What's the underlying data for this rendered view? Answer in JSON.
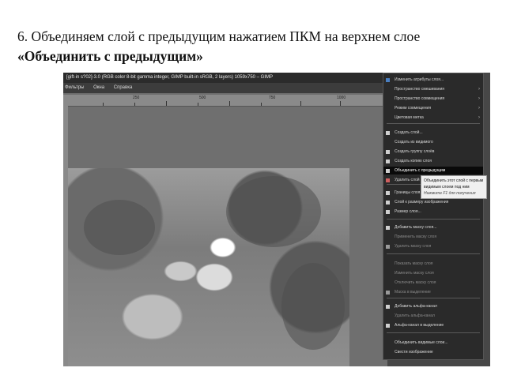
{
  "instruction": {
    "text": "6. Объединяем слой с предыдущим нажатием ПКМ на верхнем слое ",
    "bold": "«Объединить с предыдущим»"
  },
  "window": {
    "title": "[gift-in s?02]-3.0 (RGB color 8-bit gamma integer, GIMP built-in sRGB, 2 layers) 1059x750 – GIMP",
    "menu": [
      "Фильтры",
      "Окна",
      "Справка"
    ]
  },
  "ruler": [
    "250",
    "500",
    "750",
    "1000"
  ],
  "context_menu": {
    "items": [
      {
        "label": "Изменить атрибуты слоя...",
        "icon": "layer-attributes-icon",
        "submenu": false,
        "dim": false
      },
      {
        "label": "Пространство смешивания",
        "icon": "",
        "submenu": true,
        "dim": false
      },
      {
        "label": "Пространство совмещения",
        "icon": "",
        "submenu": true,
        "dim": false
      },
      {
        "label": "Режим совмещения",
        "icon": "",
        "submenu": true,
        "dim": false
      },
      {
        "label": "Цветовая метка",
        "icon": "",
        "submenu": true,
        "dim": false
      },
      {
        "label": "Создать слой...",
        "icon": "new-layer-icon",
        "submenu": false,
        "dim": false
      },
      {
        "label": "Создать из видимого",
        "icon": "",
        "submenu": false,
        "dim": false
      },
      {
        "label": "Создать группу слоёв",
        "icon": "layer-group-icon",
        "submenu": false,
        "dim": false
      },
      {
        "label": "Создать копию слоя",
        "icon": "duplicate-layer-icon",
        "submenu": false,
        "dim": false
      },
      {
        "label": "Объединить с предыдущим",
        "icon": "merge-down-icon",
        "submenu": false,
        "dim": false,
        "highlight": true
      },
      {
        "label": "Удалить слой",
        "icon": "delete-layer-icon",
        "submenu": false,
        "dim": false
      },
      {
        "label": "Границы слоя...",
        "icon": "layer-boundary-icon",
        "submenu": false,
        "dim": false
      },
      {
        "label": "Слой к размеру изображения",
        "icon": "layer-to-image-size-icon",
        "submenu": false,
        "dim": false
      },
      {
        "label": "Размер слоя...",
        "icon": "scale-layer-icon",
        "submenu": false,
        "dim": false
      },
      {
        "label": "Добавить маску слоя...",
        "icon": "add-mask-icon",
        "submenu": false,
        "dim": false
      },
      {
        "label": "Применить маску слоя",
        "icon": "",
        "submenu": false,
        "dim": true
      },
      {
        "label": "Удалить маску слоя",
        "icon": "delete-mask-icon",
        "submenu": false,
        "dim": true
      },
      {
        "label": "Показать маску слоя",
        "icon": "",
        "submenu": false,
        "dim": true
      },
      {
        "label": "Изменить маску слоя",
        "icon": "",
        "submenu": false,
        "dim": true
      },
      {
        "label": "Отключить маску слоя",
        "icon": "",
        "submenu": false,
        "dim": true
      },
      {
        "label": "Маска в выделение",
        "icon": "mask-to-selection-icon",
        "submenu": false,
        "dim": true
      },
      {
        "label": "Добавить альфа-канал",
        "icon": "alpha-channel-icon",
        "submenu": false,
        "dim": false
      },
      {
        "label": "Удалить альфа-канал",
        "icon": "",
        "submenu": false,
        "dim": true
      },
      {
        "label": "Альфа-канал в выделение",
        "icon": "alpha-to-selection-icon",
        "submenu": false,
        "dim": false
      },
      {
        "label": "Объединить видимые слои...",
        "icon": "",
        "submenu": false,
        "dim": false
      },
      {
        "label": "Свести изображение",
        "icon": "",
        "submenu": false,
        "dim": false
      }
    ]
  },
  "tooltip": {
    "text": "Объединить этот слой с первым видимым слоем под ним",
    "hint": "Нажмите F1 для получения справки"
  }
}
